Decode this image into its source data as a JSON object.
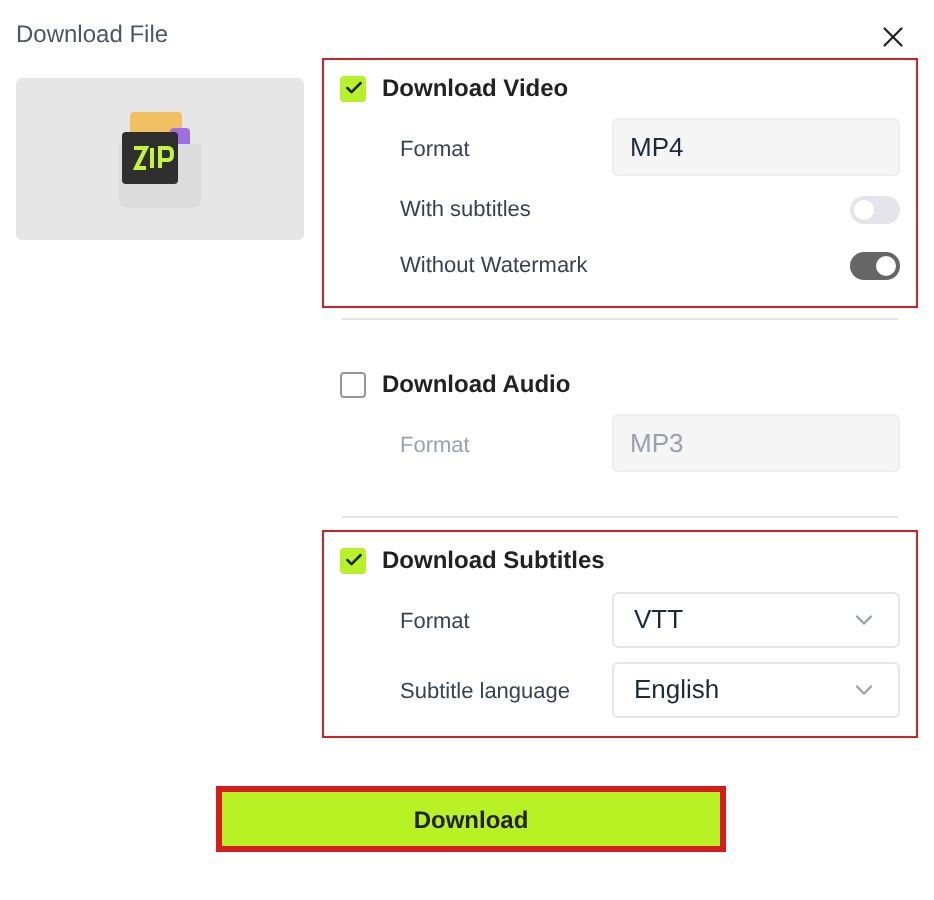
{
  "dialog": {
    "title": "Download File"
  },
  "sections": [
    {
      "title": "Download Video",
      "checked": true,
      "highlighted": true,
      "rows": [
        {
          "kind": "field",
          "label": "Format",
          "value": "MP4",
          "disabled": false
        },
        {
          "kind": "toggle",
          "label": "With subtitles",
          "on": false
        },
        {
          "kind": "toggle",
          "label": "Without Watermark",
          "on": true
        }
      ]
    },
    {
      "title": "Download Audio",
      "checked": false,
      "highlighted": false,
      "rows": [
        {
          "kind": "field",
          "label": "Format",
          "value": "MP3",
          "disabled": true
        }
      ]
    },
    {
      "title": "Download Subtitles",
      "checked": true,
      "highlighted": true,
      "rows": [
        {
          "kind": "select",
          "label": "Format",
          "value": "VTT"
        },
        {
          "kind": "select",
          "label": "Subtitle language",
          "value": "English"
        }
      ]
    }
  ],
  "download_button": {
    "label": "Download",
    "highlighted": true
  }
}
